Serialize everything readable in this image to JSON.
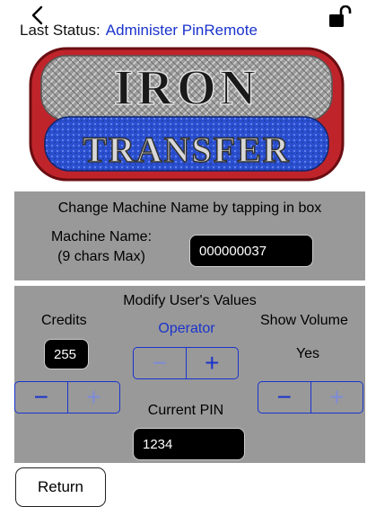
{
  "header": {
    "status_label": "Last Status:",
    "status_value": "Administer PinRemote",
    "status_color": "#1a33cc",
    "back_icon": "chevron-left-icon",
    "lock_icon": "unlocked-padlock-icon"
  },
  "logo": {
    "line1": "IRON",
    "line2": "TRANSFER",
    "frame_color": "#c0242b",
    "bottom_panel_color": "#2346c8"
  },
  "machine_name_panel": {
    "title": "Change Machine Name by tapping in box",
    "label_line1": "Machine Name:",
    "label_line2": "(9 chars Max)",
    "value": "000000037"
  },
  "user_values_panel": {
    "title": "Modify User's Values",
    "credits": {
      "label": "Credits",
      "value": "255"
    },
    "operator": {
      "label": "Operator"
    },
    "show_volume": {
      "label": "Show Volume",
      "value": "Yes"
    },
    "current_pin": {
      "label": "Current PIN",
      "value": "1234"
    },
    "stepper_minus": "−",
    "stepper_plus": "+"
  },
  "return_label": "Return"
}
